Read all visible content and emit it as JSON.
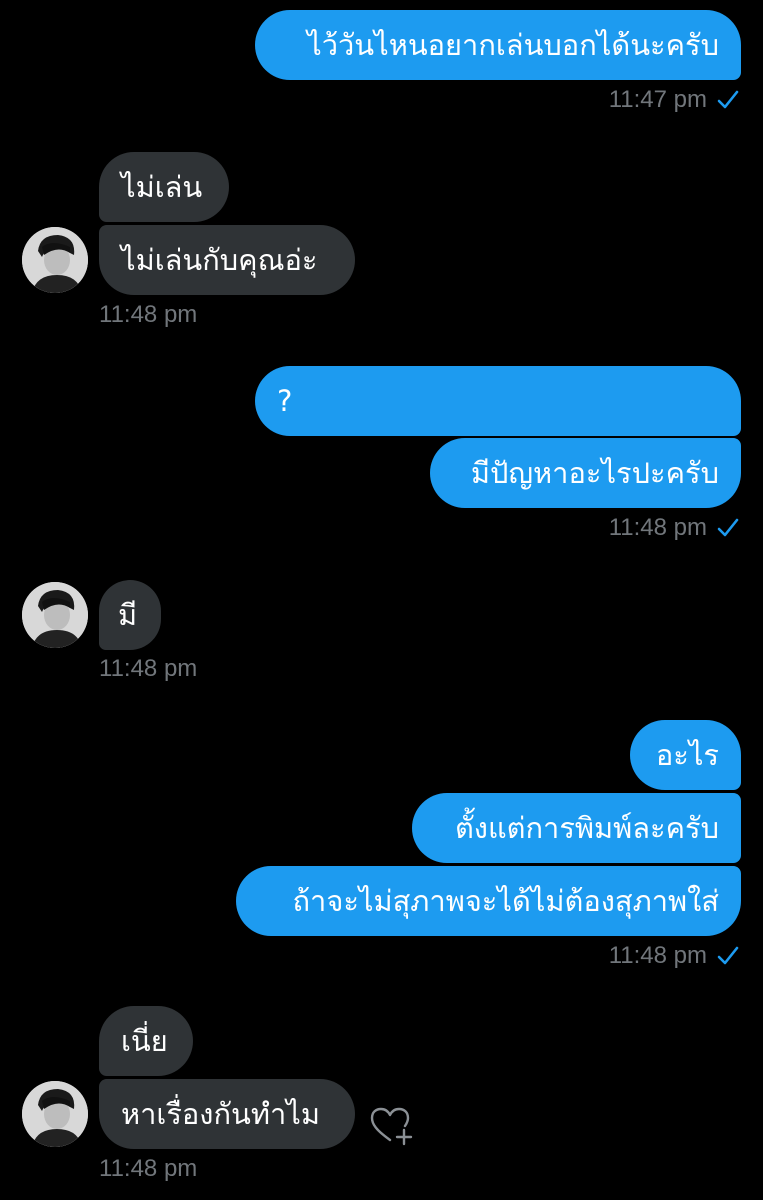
{
  "conversation": {
    "messages": [
      {
        "text": "ไว้วันไหนอยากเล่นบอกได้นะครับ"
      },
      {
        "time": "11:47 pm"
      },
      {
        "text": "ไม่เล่น"
      },
      {
        "text": "ไม่เล่นกับคุณอ่ะ"
      },
      {
        "time": "11:48 pm"
      },
      {
        "text": "?"
      },
      {
        "text": "มีปัญหาอะไรปะครับ"
      },
      {
        "time": "11:48 pm"
      },
      {
        "text": "มี"
      },
      {
        "time": "11:48 pm"
      },
      {
        "text": "อะไร"
      },
      {
        "text": "ตั้งแต่การพิมพ์ละครับ"
      },
      {
        "text": "ถ้าจะไม่สุภาพจะได้ไม่ต้องสุภาพใส่"
      },
      {
        "time": "11:48 pm"
      },
      {
        "text": "เนี่ย"
      },
      {
        "text": "หาเรื่องกันทำไม"
      },
      {
        "time": "11:48 pm"
      }
    ]
  },
  "colors": {
    "background": "#000000",
    "sent_bubble": "#1d9bf0",
    "received_bubble": "#2f3336",
    "timestamp": "#71767b"
  },
  "icons": {
    "read_receipt": "checkmark-icon",
    "avatar": "user-avatar",
    "reaction": "heart-plus-icon"
  }
}
